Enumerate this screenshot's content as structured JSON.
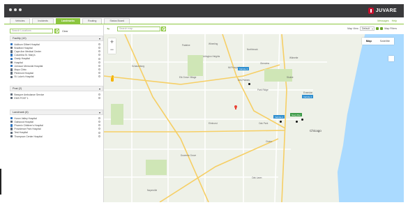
{
  "app": {
    "brand": "JUVARE"
  },
  "tabs": [
    {
      "label": "Vehicles",
      "active": false
    },
    {
      "label": "Incidents",
      "active": false
    },
    {
      "label": "Landmarks",
      "active": true
    },
    {
      "label": "Routing",
      "active": false
    },
    {
      "label": "Status Board",
      "active": false
    }
  ],
  "header_links": {
    "messages": "Messages",
    "help": "Help"
  },
  "sidebar": {
    "search_placeholder": "Search Locations",
    "clear_label": "Clear",
    "sections": [
      {
        "title": "Facility (10)",
        "items": [
          {
            "label": "Addison Gilbert Hospital",
            "icon": "hospital-icon",
            "color": "#2f74c0"
          },
          {
            "label": "Bradford Hospital",
            "icon": "building-icon",
            "color": "#5d6a7a"
          },
          {
            "label": "Cape Ann Medical Center",
            "icon": "building-icon",
            "color": "#5d6a7a"
          },
          {
            "label": "Columbia St. Mary's",
            "icon": "hospital-icon",
            "color": "#2f74c0"
          },
          {
            "label": "Grady Hospital",
            "icon": "hospital-icon",
            "color": "#2f74c0"
          },
          {
            "label": "Hospital",
            "icon": "building-icon",
            "color": "#5d6a7a"
          },
          {
            "label": "Johnson Memorial Hospital",
            "icon": "hospital-icon",
            "color": "#2f74c0"
          },
          {
            "label": "Mayo Clinic",
            "icon": "building-icon",
            "color": "#5d6a7a"
          },
          {
            "label": "Piedmont Hospital",
            "icon": "building-icon",
            "color": "#5d6a7a"
          },
          {
            "label": "St. Luke's Hospital",
            "icon": "building-icon",
            "color": "#5d6a7a"
          }
        ]
      },
      {
        "title": "Post (2)",
        "items": [
          {
            "label": "Beaupre Ambulance Service",
            "icon": "ambulance-icon",
            "color": "#5d6a7a"
          },
          {
            "label": "EMS POST 1",
            "icon": "post-icon",
            "color": "#5d6a7a"
          }
        ]
      },
      {
        "title": "Landmark (6)",
        "items": [
          {
            "label": "Huron Valley Hospital",
            "icon": "hospital-icon",
            "color": "#2f74c0"
          },
          {
            "label": "Oakwood Hospital",
            "icon": "building-icon",
            "color": "#5d6a7a"
          },
          {
            "label": "Phoenix Children's Hospital",
            "icon": "hospital-icon",
            "color": "#2f74c0"
          },
          {
            "label": "Providence Park Hospital",
            "icon": "building-icon",
            "color": "#5d6a7a"
          },
          {
            "label": "Test Hospital",
            "icon": "building-icon",
            "color": "#5d6a7a"
          },
          {
            "label": "Thompson Center Hospital",
            "icon": "building-icon",
            "color": "#5d6a7a"
          }
        ]
      }
    ]
  },
  "map_toolbar": {
    "search_placeholder": "Search map",
    "map_view_label": "Map View",
    "map_view_value": "Default",
    "map_filters_label": "Map Filters"
  },
  "map": {
    "type_buttons": [
      {
        "label": "Map",
        "active": true
      },
      {
        "label": "Satellite",
        "active": false
      }
    ],
    "city_label": "Chicago",
    "place_labels": [
      "Palatine",
      "Wheeling",
      "Northbrook",
      "Glenview",
      "Skokie",
      "Evanston",
      "Des Plaines",
      "Park Ridge",
      "Schaumburg",
      "Elk Grove Village",
      "Arlington Heights",
      "Mt Prospect",
      "Elmhurst",
      "Oak Park",
      "Cicero",
      "Downers Grove",
      "Naperville",
      "Oak Lawn",
      "Wilmette"
    ],
    "location_labels": [
      "Vehicle 4",
      "Vehicle 2",
      "Navy Pier"
    ]
  }
}
